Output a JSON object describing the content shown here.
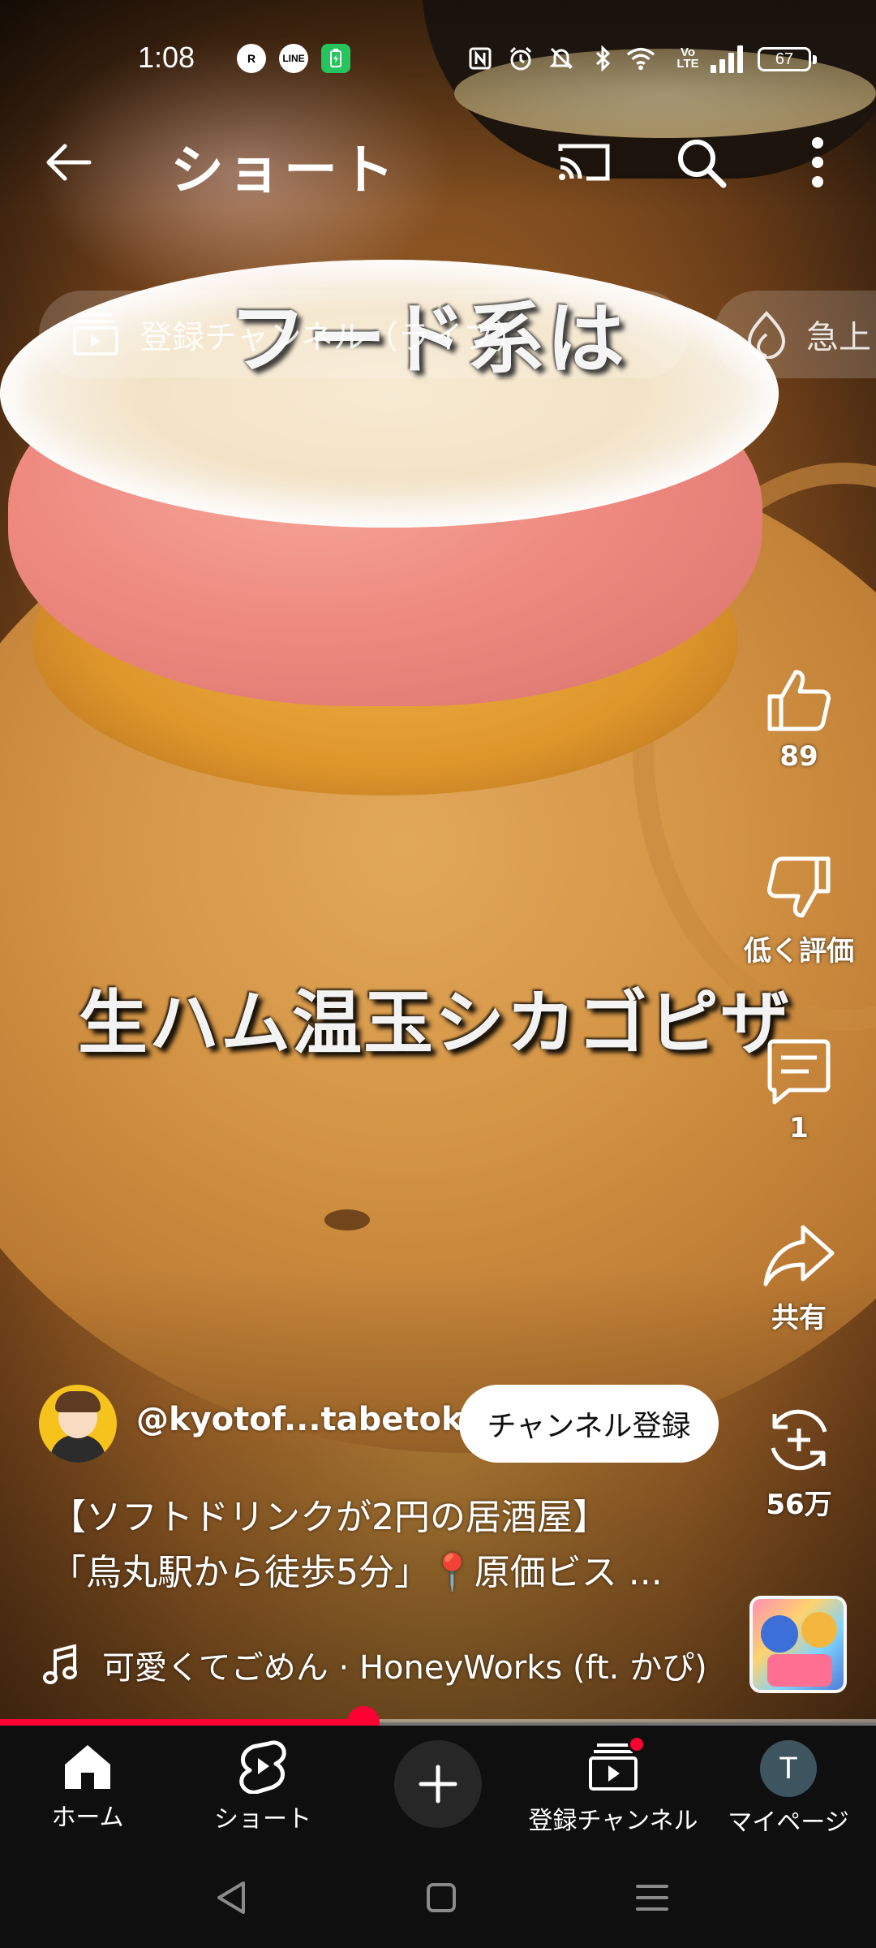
{
  "status_bar": {
    "time": "1:08",
    "battery": "67",
    "notification_icons": [
      "rakuten-link-icon",
      "line-icon",
      "battery-saver-icon"
    ],
    "system_icons": [
      "nfc-icon",
      "alarm-icon",
      "mute-icon",
      "bluetooth-icon",
      "wifi-icon",
      "volte-icon",
      "signal-icon",
      "battery-icon"
    ]
  },
  "app_bar": {
    "title": "ショート",
    "icons": [
      "back-arrow-icon",
      "cast-icon",
      "search-icon",
      "more-vert-icon"
    ]
  },
  "chips": [
    {
      "label": "登録チャンネル（ライブ）",
      "icon": "subscriptions-icon"
    },
    {
      "label": "急上",
      "icon": "trending-icon"
    }
  ],
  "video": {
    "caption_top": "フード系は",
    "caption_middle": "生ハム温玉シカゴピザ"
  },
  "actions": {
    "like_count": "89",
    "dislike_label": "低く評価",
    "comment_count": "1",
    "share_label": "共有",
    "remix_count": "56万"
  },
  "channel": {
    "handle": "@kyotof...tabetoku",
    "subscribe_label": "チャンネル登録"
  },
  "description": {
    "line1": "【ソフトドリンクが2円の居酒屋】",
    "line2": "「烏丸駅から徒歩5分」📍原価ビス ..."
  },
  "music": {
    "text": "可愛くてごめん · HoneyWorks (ft. かぴ)"
  },
  "progress": {
    "fraction": 0.415
  },
  "bottom_nav": {
    "items": [
      {
        "label": "ホーム",
        "icon": "home-icon"
      },
      {
        "label": "ショート",
        "icon": "shorts-icon"
      },
      {
        "label": "",
        "icon": "add-icon"
      },
      {
        "label": "登録チャンネル",
        "icon": "subscriptions-icon"
      },
      {
        "label": "マイページ",
        "icon": "avatar-icon",
        "avatar_letter": "T"
      }
    ]
  },
  "system_nav": {
    "icons": [
      "back-triangle-icon",
      "home-square-icon",
      "recents-menu-icon"
    ]
  },
  "colors": {
    "accent": "#ff0033",
    "nav_background": "#0f0f0f",
    "battery_saver": "#25c45d"
  }
}
